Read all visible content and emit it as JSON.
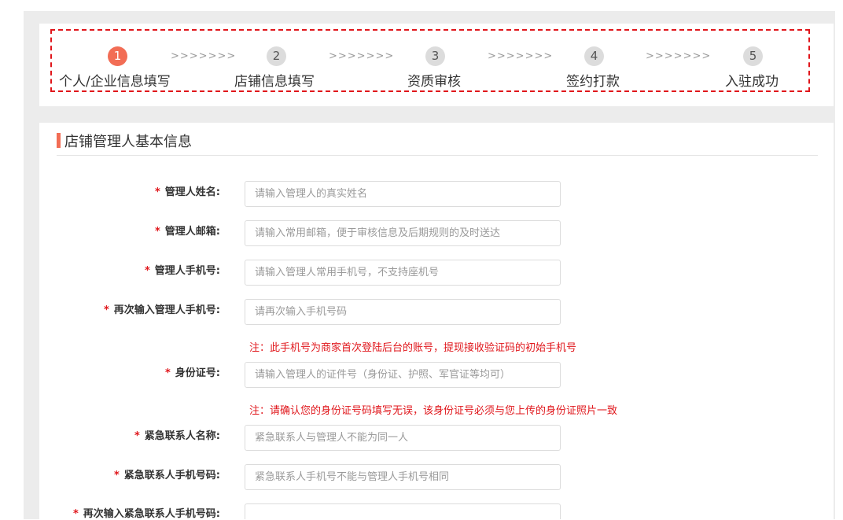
{
  "steps": [
    {
      "num": "1",
      "label": "个人/企业信息填写",
      "active": true
    },
    {
      "num": "2",
      "label": "店铺信息填写",
      "active": false
    },
    {
      "num": "3",
      "label": "资质审核",
      "active": false
    },
    {
      "num": "4",
      "label": "签约打款",
      "active": false
    },
    {
      "num": "5",
      "label": "入驻成功",
      "active": false
    }
  ],
  "step_arrows": ">>>>>>>",
  "section": {
    "title": "店铺管理人基本信息"
  },
  "fields": [
    {
      "label": "管理人姓名:",
      "placeholder": "请输入管理人的真实姓名"
    },
    {
      "label": "管理人邮箱:",
      "placeholder": "请输入常用邮箱，便于审核信息及后期规则的及时送达"
    },
    {
      "label": "管理人手机号:",
      "placeholder": "请输入管理人常用手机号，不支持座机号"
    },
    {
      "label": "再次输入管理人手机号:",
      "placeholder": "请再次输入手机号码"
    },
    {
      "label": "身份证号:",
      "placeholder": "请输入管理人的证件号（身份证、护照、军官证等均可）"
    },
    {
      "label": "紧急联系人名称:",
      "placeholder": "紧急联系人与管理人不能为同一人"
    },
    {
      "label": "紧急联系人手机号码:",
      "placeholder": "紧急联系人手机号不能与管理人手机号相同"
    },
    {
      "label": "再次输入紧急联系人手机号码:",
      "placeholder": ""
    }
  ],
  "notes": {
    "phone": "注：此手机号为商家首次登陆后台的账号，提现接收验证码的初始手机号",
    "id": "注：请确认您的身份证号码填写无误，该身份证号必须与您上传的身份证照片一致"
  },
  "required_mark": "*",
  "colors": {
    "accent": "#f26d55",
    "required": "#e0161b",
    "border_dashed": "#e0161b"
  }
}
